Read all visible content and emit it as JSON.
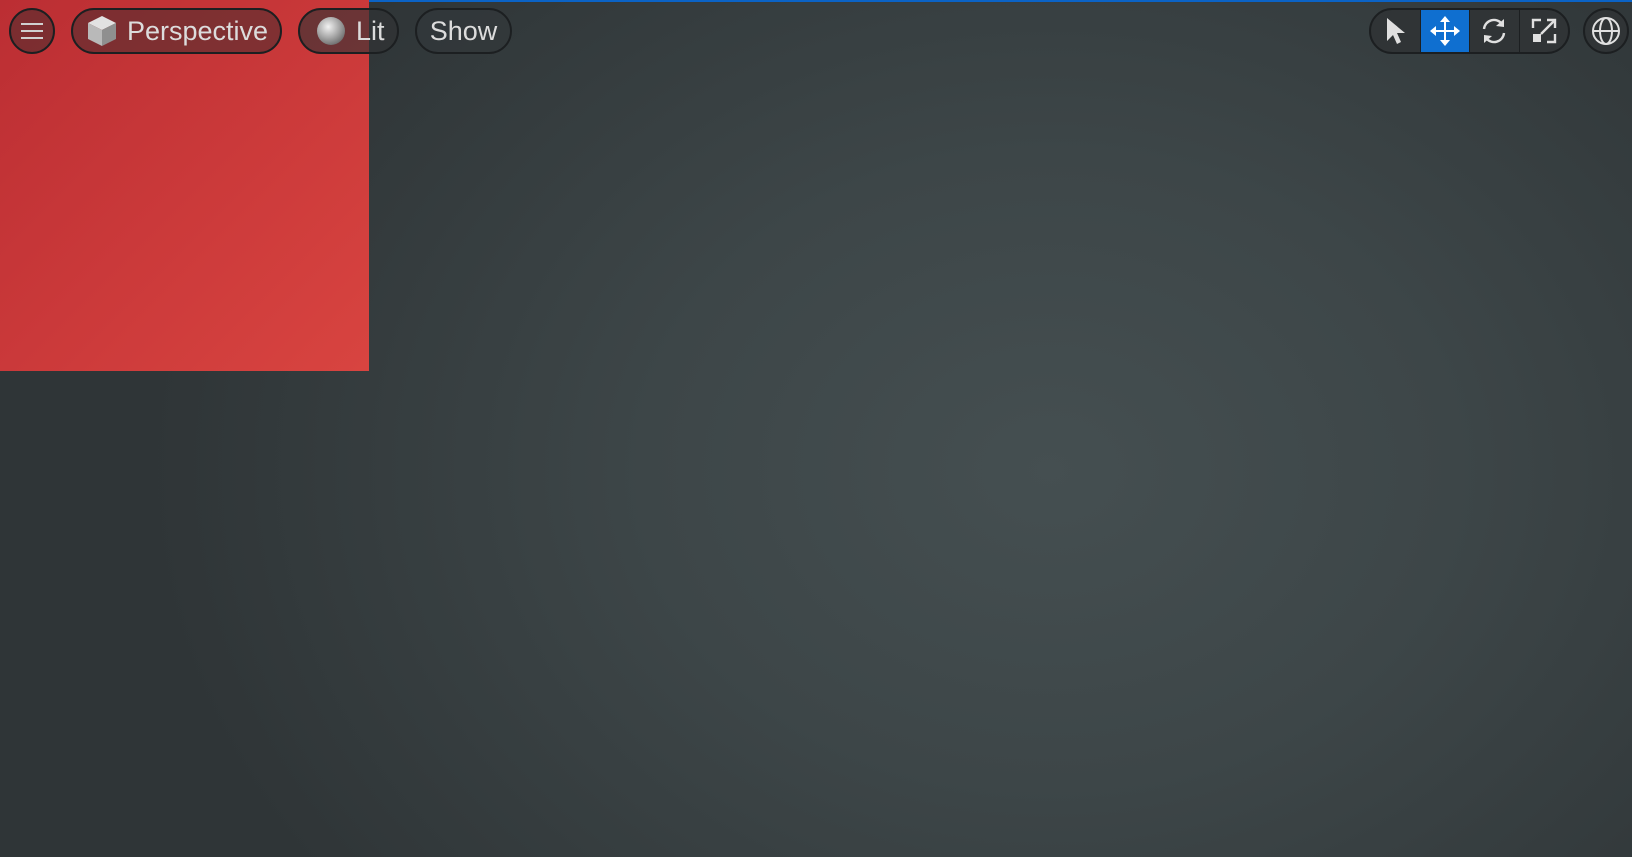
{
  "viewport": {
    "background_color": "#3d4648",
    "accent_color": "#0b63c6",
    "object_color": "#cd3b3b"
  },
  "toolbar_left": {
    "menu_icon": "hamburger-icon",
    "perspective": {
      "label": "Perspective",
      "icon": "cube-icon"
    },
    "lit": {
      "label": "Lit",
      "icon": "sphere-icon"
    },
    "show": {
      "label": "Show"
    }
  },
  "toolbar_right": {
    "tools": [
      {
        "name": "select",
        "icon": "cursor-arrow-icon",
        "active": false
      },
      {
        "name": "translate",
        "icon": "move-arrows-icon",
        "active": true
      },
      {
        "name": "rotate",
        "icon": "rotate-icon",
        "active": false
      },
      {
        "name": "scale",
        "icon": "scale-icon",
        "active": false
      }
    ],
    "world_icon": "globe-icon",
    "active_color": "#0f6fd0"
  }
}
